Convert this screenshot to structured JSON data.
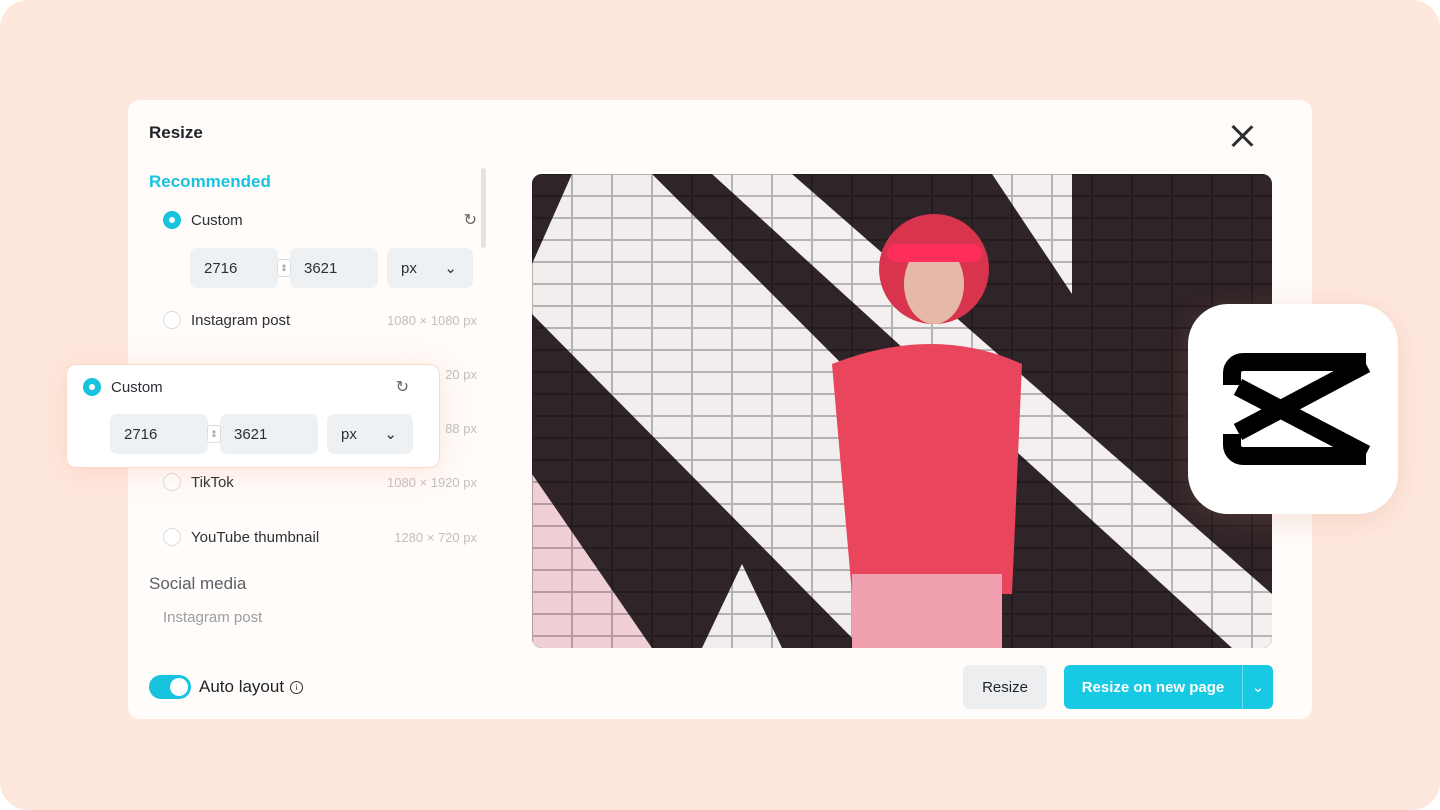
{
  "dialog": {
    "title": "Resize"
  },
  "sections": {
    "recommended": "Recommended",
    "social": "Social media"
  },
  "custom": {
    "label": "Custom",
    "width": "2716",
    "height": "3621",
    "unit": "px"
  },
  "presets": [
    {
      "label": "Instagram post",
      "size": "1080 × 1080 px"
    },
    {
      "label": "",
      "size": "20 px"
    },
    {
      "label": "",
      "size": "88 px"
    },
    {
      "label": "TikTok",
      "size": "1080 × 1920 px"
    },
    {
      "label": "YouTube thumbnail",
      "size": "1280 × 720 px"
    }
  ],
  "social_items": [
    "Instagram post"
  ],
  "auto_layout": {
    "label": "Auto layout",
    "enabled": true
  },
  "buttons": {
    "resize": "Resize",
    "resize_new": "Resize on new page"
  },
  "colors": {
    "accent": "#17c3de",
    "background": "#fee8de"
  },
  "icons": {
    "close": "close-icon",
    "reset": "reset-icon",
    "chevron": "chevron-down-icon",
    "info": "info-icon",
    "logo": "capcut-logo"
  }
}
